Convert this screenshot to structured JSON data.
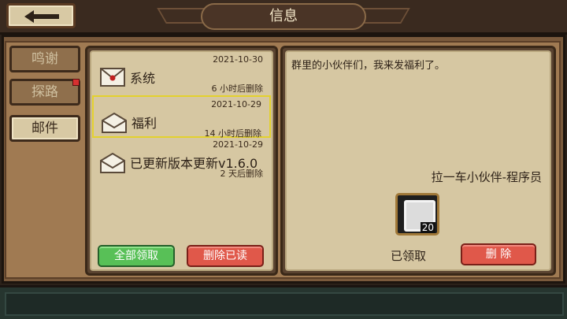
{
  "header": {
    "title": "信息",
    "back_icon": "left-arrow-icon"
  },
  "sidebar": {
    "tabs": [
      {
        "label": "鸣谢",
        "active": false,
        "badge": false
      },
      {
        "label": "探路",
        "active": false,
        "badge": true
      },
      {
        "label": "邮件",
        "active": true,
        "badge": false
      }
    ]
  },
  "mail_list": {
    "items": [
      {
        "title": "系统",
        "date": "2021-10-30",
        "expires": "6 小时后删除",
        "read": false,
        "selected": false
      },
      {
        "title": "福利",
        "date": "2021-10-29",
        "expires": "14 小时后删除",
        "read": true,
        "selected": true
      },
      {
        "title": "已更新版本更新v1.6.0",
        "date": "2021-10-29",
        "expires": "2 天后删除",
        "read": true,
        "selected": false
      }
    ],
    "claim_all_label": "全部领取",
    "delete_read_label": "删除已读"
  },
  "detail": {
    "body": "群里的小伙伴们，我来发福利了。",
    "sender": "拉一车小伙伴-程序员",
    "reward": {
      "icon": "silver-gem-icon",
      "quantity": "20"
    },
    "status": "已领取",
    "delete_label": "删  除"
  },
  "colors": {
    "accent_green": "#58c057",
    "accent_red": "#e0584a",
    "selection": "#e3d12e"
  }
}
